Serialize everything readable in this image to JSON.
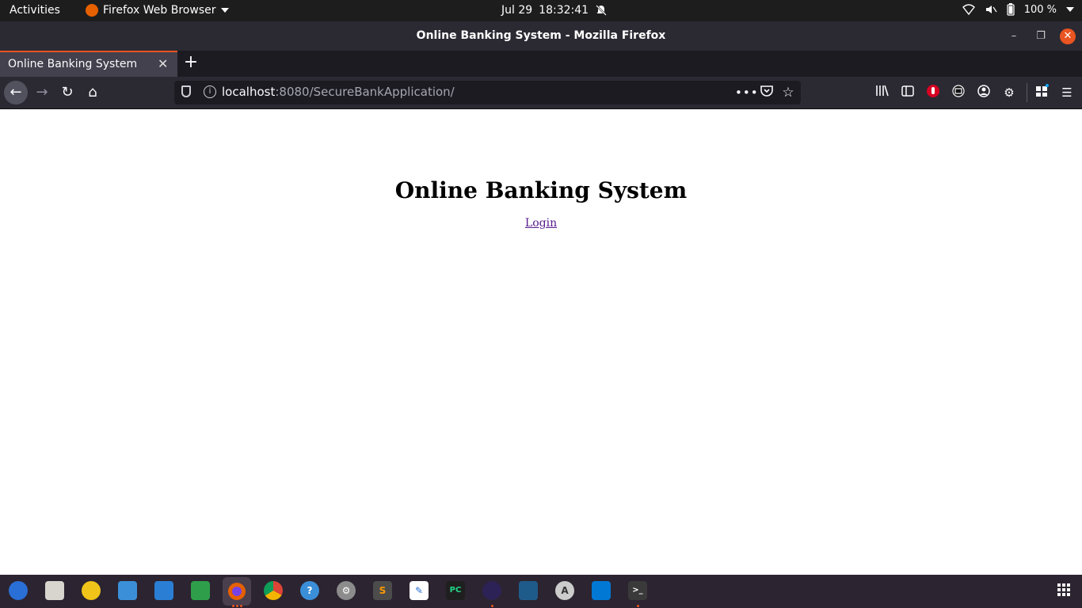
{
  "topbar": {
    "activities": "Activities",
    "app_menu": "Firefox Web Browser",
    "date": "Jul 29",
    "time": "18:32:41",
    "battery": "100 %"
  },
  "window": {
    "title": "Online Banking System - Mozilla Firefox"
  },
  "tabs": [
    {
      "label": "Online Banking System",
      "active": true
    }
  ],
  "urlbar": {
    "host": "localhost",
    "rest": ":8080/SecureBankApplication/"
  },
  "page": {
    "heading": "Online Banking System",
    "login_link": "Login",
    "link_color": "#551a8b"
  },
  "colors": {
    "accent": "#e95420",
    "topbar_bg": "#1d1d1d",
    "chrome_bg": "#2b2a33",
    "dock_bg": "#2c2430"
  },
  "dock": {
    "apps": [
      "thunderbird-icon",
      "files-icon",
      "rhythmbox-icon",
      "webapp-icon",
      "writer-icon",
      "calc-icon",
      "firefox-icon",
      "chrome-icon",
      "help-icon",
      "settings-icon",
      "sublime-icon",
      "text-editor-icon",
      "pycharm-icon",
      "eclipse-icon",
      "mysql-workbench-icon",
      "software-updater-icon",
      "vscode-icon",
      "terminal-icon"
    ]
  }
}
